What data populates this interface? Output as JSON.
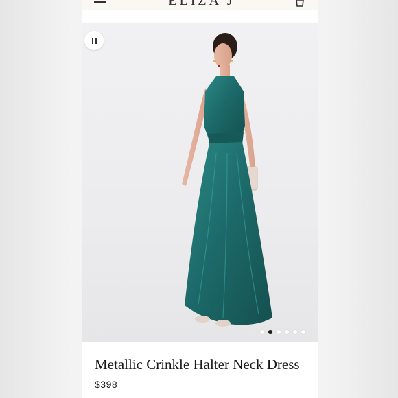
{
  "header": {
    "logo_text": "ELIZA J",
    "menu_icon": "hamburger-menu-icon",
    "bag_icon": "shopping-bag-icon"
  },
  "gallery": {
    "pause_icon": "pause-icon",
    "slide_count": 6,
    "active_slide": 2
  },
  "product": {
    "title": "Metallic Crinkle Halter Neck Dress",
    "price": "$398"
  },
  "colors": {
    "dress": "#1f6e6e",
    "header_bg": "#fbf7f2",
    "page_bg": "#f3f3f3",
    "active_dot": "#1b1b1b"
  }
}
